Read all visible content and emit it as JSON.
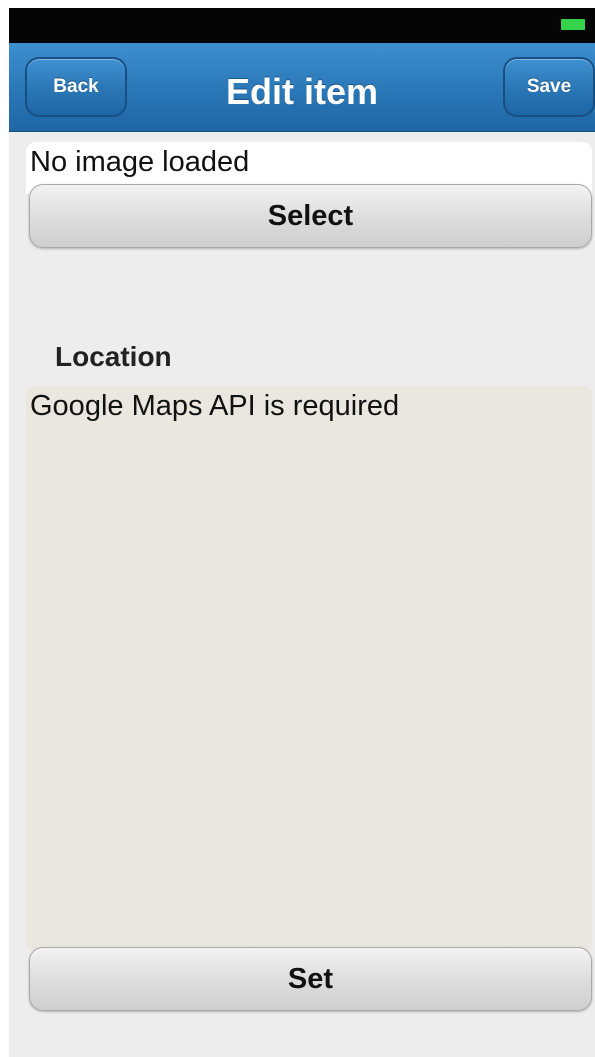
{
  "status_bar": {
    "battery_icon": "battery-icon",
    "battery_color": "#35d34a"
  },
  "nav": {
    "back_label": "Back",
    "title": "Edit item",
    "save_label": "Save",
    "bar_color": "#2b79b9"
  },
  "image": {
    "status_text": "No image loaded",
    "select_label": "Select"
  },
  "location": {
    "label": "Location",
    "map_message": "Google Maps API is required",
    "set_label": "Set"
  }
}
